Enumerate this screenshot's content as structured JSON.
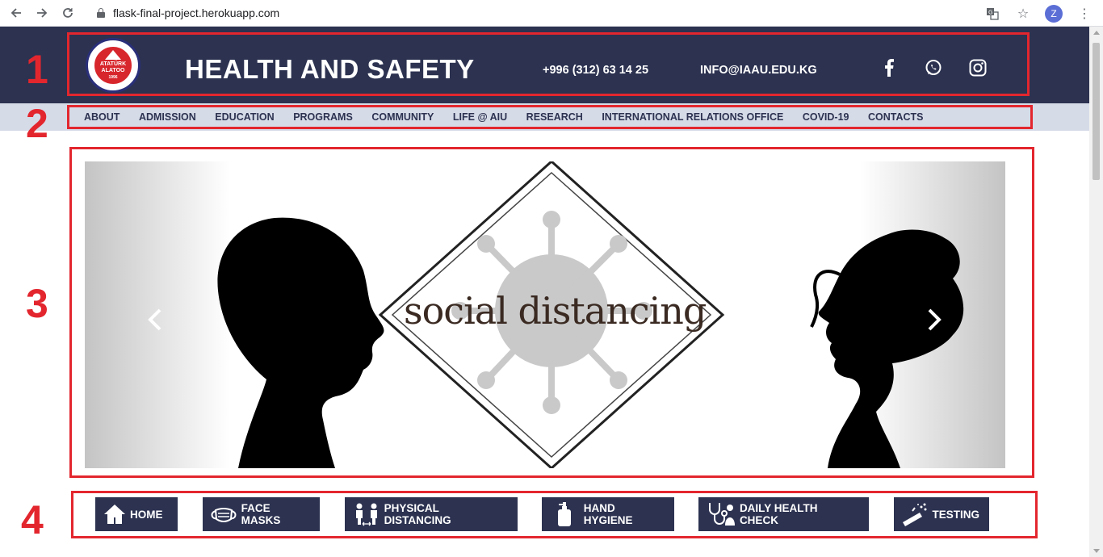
{
  "browser": {
    "url": "flask-final-project.herokuapp.com",
    "profile_initial": "Z"
  },
  "header": {
    "title": "HEALTH AND SAFETY",
    "phone": "+996 (312) 63 14 25",
    "email": "INFO@IAAU.EDU.KG",
    "logo_text_top": "ATATÜRK",
    "logo_text_bottom": "ALATOO",
    "logo_year": "1996"
  },
  "menu": {
    "items": [
      "ABOUT",
      "ADMISSION",
      "EDUCATION",
      "PROGRAMS",
      "COMMUNITY",
      "LIFE @ AIU",
      "RESEARCH",
      "INTERNATIONAL RELATIONS OFFICE",
      "COVID-19",
      "CONTACTS"
    ]
  },
  "hero": {
    "caption": "social distancing"
  },
  "subnav": {
    "items": [
      "HOME",
      "FACE MASKS",
      "PHYSICAL DISTANCING",
      "HAND HYGIENE",
      "DAILY HEALTH CHECK",
      "TESTING"
    ]
  },
  "annotations": {
    "labels": [
      "1",
      "2",
      "3",
      "4"
    ]
  },
  "colors": {
    "header_bg": "#2c3250",
    "menu_bg": "#d6dbe8",
    "highlight": "#e3262e"
  }
}
